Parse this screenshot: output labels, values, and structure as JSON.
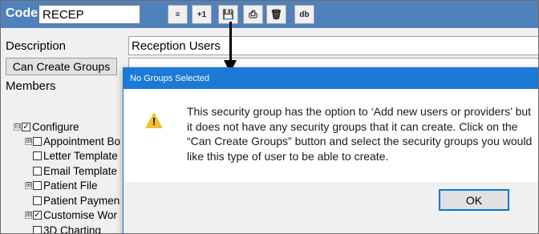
{
  "header": {
    "code_label": "Code",
    "code_value": "RECEP",
    "toolbar_buttons": [
      {
        "icon": "align-left-icon",
        "label": "≡"
      },
      {
        "icon": "plus-one-icon",
        "label": "+1"
      },
      {
        "icon": "floppy-disk-icon",
        "label": "💾"
      },
      {
        "icon": "print-icon",
        "label": "⎙"
      },
      {
        "icon": "trash-icon",
        "label": "🗑"
      },
      {
        "icon": "db-icon",
        "label": "db"
      }
    ]
  },
  "form": {
    "description_label": "Description",
    "description_value": "Reception Users",
    "can_create_groups_label": "Can Create Groups",
    "members_label": "Members"
  },
  "tree": {
    "items": [
      {
        "label": "Configure",
        "checked": true,
        "expander": "⊟"
      },
      {
        "label": "Appointment Bo",
        "checked": false,
        "expander": "⊞"
      },
      {
        "label": "Letter Template",
        "checked": false,
        "expander": ""
      },
      {
        "label": "Email Template",
        "checked": false,
        "expander": ""
      },
      {
        "label": "Patient File",
        "checked": false,
        "expander": "⊞"
      },
      {
        "label": "Patient Paymen",
        "checked": false,
        "expander": ""
      },
      {
        "label": "Customise Wor",
        "checked": true,
        "expander": "⊞"
      },
      {
        "label": "3D Charting",
        "checked": false,
        "expander": ""
      }
    ]
  },
  "dialog": {
    "title": "No Groups Selected",
    "message": "This security group has the option to ‘Add new users or providers’ but it does not have any security groups that it can create. Click on the “Can Create Groups” button and select the security groups you would like this type of user to be able to create.",
    "ok_label": "OK"
  },
  "colors": {
    "header_bg": "#4f81bd",
    "dialog_title_bg": "#1c79d6",
    "warning": "#f2c12e"
  }
}
